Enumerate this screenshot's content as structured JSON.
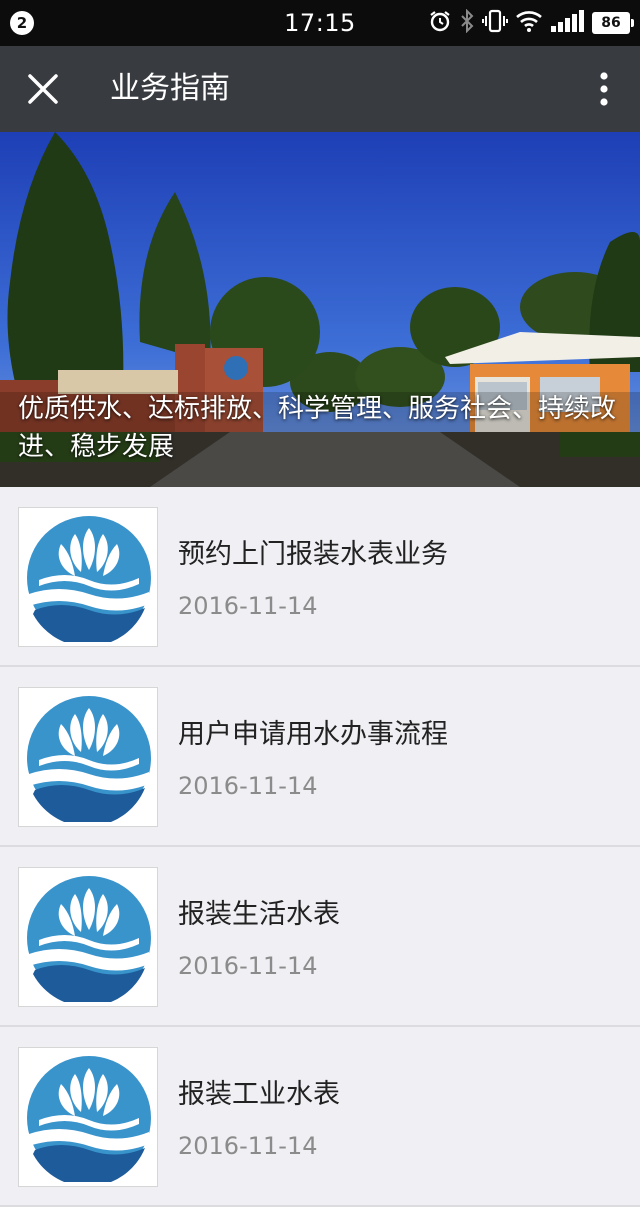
{
  "status_bar": {
    "notification_count": "2",
    "time": "17:15",
    "battery": "86",
    "icons": [
      "alarm-icon",
      "bluetooth-icon",
      "vibrate-icon",
      "wifi-icon",
      "signal-icon",
      "battery-icon"
    ]
  },
  "navbar": {
    "title": "业务指南",
    "close_icon": "close-icon",
    "more_icon": "more-vertical-icon"
  },
  "banner": {
    "caption": "优质供水、达标排放、科学管理、服务社会、持续改进、稳步发展"
  },
  "items": [
    {
      "title": "预约上门报装水表业务",
      "date": "2016-11-14"
    },
    {
      "title": "用户申请用水办事流程",
      "date": "2016-11-14"
    },
    {
      "title": "报装生活水表",
      "date": "2016-11-14"
    },
    {
      "title": "报装工业水表",
      "date": "2016-11-14"
    }
  ],
  "colors": {
    "status_bar": "#0c0c0c",
    "nav_bar": "#383b40",
    "background": "#efeff4",
    "logo_blue": "#3a94cc",
    "logo_dark_blue": "#1d5b9a",
    "date_gray": "#8b8b8b"
  }
}
